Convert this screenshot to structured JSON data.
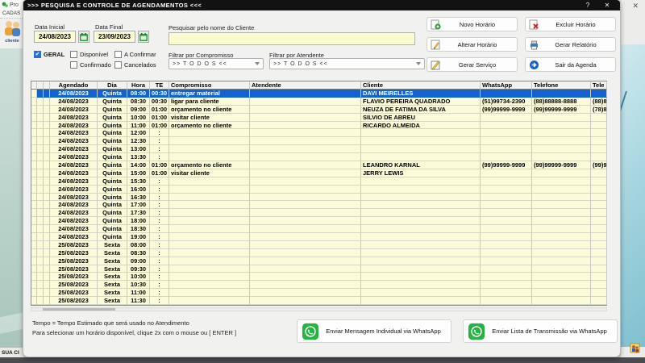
{
  "window": {
    "title": ">>>  PESQUISA E CONTROLE DE AGENDAMENTOS  <<<",
    "help_label": "?",
    "close_label": "✕"
  },
  "background": {
    "left_app_title": "Pro",
    "left_menu": "CADAS",
    "left_toolbar_label": "cliente",
    "left_status": "SUA CI",
    "right_close": "✕"
  },
  "filters": {
    "data_inicial_label": "Data Inicial",
    "data_inicial_value": "24/08/2023",
    "data_final_label": "Data Final",
    "data_final_value": "23/09/2023",
    "search_label": "Pesquisar pelo nome do Cliente",
    "search_value": "",
    "checkboxes": [
      {
        "label": "GERAL",
        "checked": true
      },
      {
        "label": "Disponível",
        "checked": false
      },
      {
        "label": "A Confirmar",
        "checked": false
      },
      {
        "label": "Confirmado",
        "checked": false
      },
      {
        "label": "Cancelados",
        "checked": false
      }
    ],
    "compromisso_label": "Filtrar por Compromisso",
    "compromisso_value": ">> T O D O S <<",
    "atendente_label": "Filtrar por Atendente",
    "atendente_value": ">> T O D O S <<"
  },
  "actions": [
    {
      "label": "Novo Horário",
      "icon": "new"
    },
    {
      "label": "Excluir Horário",
      "icon": "delete"
    },
    {
      "label": "Alterar Horário",
      "icon": "edit"
    },
    {
      "label": "Gerar Relatório",
      "icon": "report"
    },
    {
      "label": "Gerar Serviço",
      "icon": "service"
    },
    {
      "label": "Sair da Agenda",
      "icon": "exit"
    }
  ],
  "table": {
    "headers": [
      "Agendado",
      "Dia",
      "Hora",
      "TE",
      "Compromisso",
      "Atendente",
      "Cliente",
      "WhatsApp",
      "Telefone",
      "Tele"
    ],
    "rows": [
      {
        "selected": true,
        "cells": [
          "24/08/2023",
          "Quinta",
          "08:00",
          "00:30",
          "entregar material",
          "",
          "DAVI MEIRELLES",
          "",
          "",
          ""
        ]
      },
      {
        "selected": false,
        "cells": [
          "24/08/2023",
          "Quinta",
          "08:30",
          "00:30",
          "ligar para cliente",
          "",
          "FLAVIO PEREIRA QUADRADO",
          "(51)99734-2390",
          "(88)88888-8888",
          "(88)8"
        ]
      },
      {
        "selected": false,
        "cells": [
          "24/08/2023",
          "Quinta",
          "09:00",
          "01:00",
          "orçamento no cliente",
          "",
          "NEUZA DE FATIMA DA SILVA",
          "(99)99999-9999",
          "(99)99999-9999",
          "(78)8"
        ]
      },
      {
        "selected": false,
        "cells": [
          "24/08/2023",
          "Quinta",
          "10:00",
          "01:00",
          "visitar cliente",
          "",
          "SILVIO DE ABREU",
          "",
          "",
          ""
        ]
      },
      {
        "selected": false,
        "cells": [
          "24/08/2023",
          "Quinta",
          "11:00",
          "01:00",
          "orçamento no cliente",
          "",
          "RICARDO ALMEIDA",
          "",
          "",
          ""
        ]
      },
      {
        "selected": false,
        "cells": [
          "24/08/2023",
          "Quinta",
          "12:00",
          ":",
          "",
          "",
          "",
          "",
          "",
          ""
        ]
      },
      {
        "selected": false,
        "cells": [
          "24/08/2023",
          "Quinta",
          "12:30",
          ":",
          "",
          "",
          "",
          "",
          "",
          ""
        ]
      },
      {
        "selected": false,
        "cells": [
          "24/08/2023",
          "Quinta",
          "13:00",
          ":",
          "",
          "",
          "",
          "",
          "",
          ""
        ]
      },
      {
        "selected": false,
        "cells": [
          "24/08/2023",
          "Quinta",
          "13:30",
          ":",
          "",
          "",
          "",
          "",
          "",
          ""
        ]
      },
      {
        "selected": false,
        "cells": [
          "24/08/2023",
          "Quinta",
          "14:00",
          "01:00",
          "orçamento no cliente",
          "",
          "LEANDRO KARNAL",
          "(99)99999-9999",
          "(99)99999-9999",
          "(99)9"
        ]
      },
      {
        "selected": false,
        "cells": [
          "24/08/2023",
          "Quinta",
          "15:00",
          "01:00",
          "visitar cliente",
          "",
          "JERRY LEWIS",
          "",
          "",
          ""
        ]
      },
      {
        "selected": false,
        "cells": [
          "24/08/2023",
          "Quinta",
          "15:30",
          ":",
          "",
          "",
          "",
          "",
          "",
          ""
        ]
      },
      {
        "selected": false,
        "cells": [
          "24/08/2023",
          "Quinta",
          "16:00",
          ":",
          "",
          "",
          "",
          "",
          "",
          ""
        ]
      },
      {
        "selected": false,
        "cells": [
          "24/08/2023",
          "Quinta",
          "16:30",
          ":",
          "",
          "",
          "",
          "",
          "",
          ""
        ]
      },
      {
        "selected": false,
        "cells": [
          "24/08/2023",
          "Quinta",
          "17:00",
          ":",
          "",
          "",
          "",
          "",
          "",
          ""
        ]
      },
      {
        "selected": false,
        "cells": [
          "24/08/2023",
          "Quinta",
          "17:30",
          ":",
          "",
          "",
          "",
          "",
          "",
          ""
        ]
      },
      {
        "selected": false,
        "cells": [
          "24/08/2023",
          "Quinta",
          "18:00",
          ":",
          "",
          "",
          "",
          "",
          "",
          ""
        ]
      },
      {
        "selected": false,
        "cells": [
          "24/08/2023",
          "Quinta",
          "18:30",
          ":",
          "",
          "",
          "",
          "",
          "",
          ""
        ]
      },
      {
        "selected": false,
        "cells": [
          "24/08/2023",
          "Quinta",
          "19:00",
          ":",
          "",
          "",
          "",
          "",
          "",
          ""
        ]
      },
      {
        "selected": false,
        "cells": [
          "25/08/2023",
          "Sexta",
          "08:00",
          ":",
          "",
          "",
          "",
          "",
          "",
          ""
        ]
      },
      {
        "selected": false,
        "cells": [
          "25/08/2023",
          "Sexta",
          "08:30",
          ":",
          "",
          "",
          "",
          "",
          "",
          ""
        ]
      },
      {
        "selected": false,
        "cells": [
          "25/08/2023",
          "Sexta",
          "09:00",
          ":",
          "",
          "",
          "",
          "",
          "",
          ""
        ]
      },
      {
        "selected": false,
        "cells": [
          "25/08/2023",
          "Sexta",
          "09:30",
          ":",
          "",
          "",
          "",
          "",
          "",
          ""
        ]
      },
      {
        "selected": false,
        "cells": [
          "25/08/2023",
          "Sexta",
          "10:00",
          ":",
          "",
          "",
          "",
          "",
          "",
          ""
        ]
      },
      {
        "selected": false,
        "cells": [
          "25/08/2023",
          "Sexta",
          "10:30",
          ":",
          "",
          "",
          "",
          "",
          "",
          ""
        ]
      },
      {
        "selected": false,
        "cells": [
          "25/08/2023",
          "Sexta",
          "11:00",
          ":",
          "",
          "",
          "",
          "",
          "",
          ""
        ]
      },
      {
        "selected": false,
        "cells": [
          "25/08/2023",
          "Sexta",
          "11:30",
          ":",
          "",
          "",
          "",
          "",
          "",
          ""
        ]
      }
    ]
  },
  "footer": {
    "note1": "Tempo = Tempo Estimado que será usado no Atendimento",
    "note2": "Para selecionar um horário disponível, clique 2x com o mouse ou [ ENTER ]",
    "whatsapp_individual": "Enviar Mensagem Individual via WhatsApp",
    "whatsapp_lista": "Enviar Lista de Transmissão via WhatsApp"
  }
}
